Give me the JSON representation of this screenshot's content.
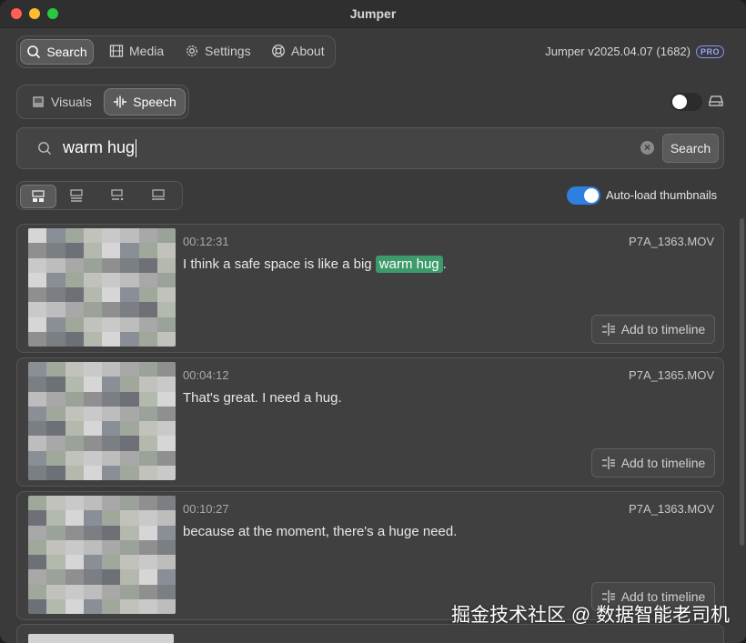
{
  "window": {
    "title": "Jumper"
  },
  "nav": {
    "tabs": [
      {
        "label": "Search",
        "icon": "magnifier-icon",
        "active": true
      },
      {
        "label": "Media",
        "icon": "film-icon",
        "active": false
      },
      {
        "label": "Settings",
        "icon": "gear-icon",
        "active": false
      },
      {
        "label": "About",
        "icon": "lifebuoy-icon",
        "active": false
      }
    ]
  },
  "version": {
    "text": "Jumper v2025.04.07 (1682)",
    "badge": "PRO"
  },
  "mode": {
    "tabs": [
      {
        "label": "Visuals",
        "icon": "frame-icon",
        "active": false
      },
      {
        "label": "Speech",
        "icon": "waveform-icon",
        "active": true
      }
    ]
  },
  "search": {
    "query": "warm hug",
    "button_label": "Search"
  },
  "autoload": {
    "label": "Auto-load thumbnails",
    "enabled": true
  },
  "results": [
    {
      "time": "00:12:31",
      "file": "P7A_1363.MOV",
      "text_before": "I think a safe space is like a big ",
      "highlight": "warm hug",
      "text_after": ".",
      "add_label": "Add to timeline"
    },
    {
      "time": "00:04:12",
      "file": "P7A_1365.MOV",
      "text_before": "That's great. I need a hug.",
      "highlight": "",
      "text_after": "",
      "add_label": "Add to timeline"
    },
    {
      "time": "00:10:27",
      "file": "P7A_1363.MOV",
      "text_before": "because at the moment, there's a huge need.",
      "highlight": "",
      "text_after": "",
      "add_label": "Add to timeline"
    }
  ],
  "colors": {
    "accent": "#2f7fe0",
    "highlight": "#3d9a6a",
    "pro_badge": "#9fa6ff"
  },
  "watermark": "掘金技术社区 @ 数据智能老司机"
}
